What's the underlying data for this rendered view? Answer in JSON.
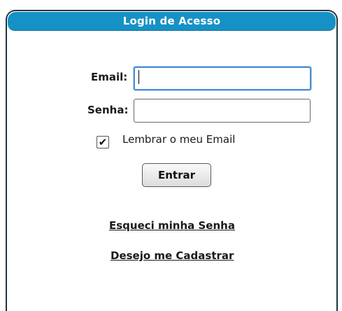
{
  "panel": {
    "title": "Login de Acesso",
    "header_color": "#1691c6",
    "border_color": "#20343f"
  },
  "form": {
    "email_label": "Email:",
    "email_value": "",
    "password_label": "Senha:",
    "password_value": "",
    "remember_label": "Lembrar o meu Email",
    "remember_checked": true,
    "submit_label": "Entrar"
  },
  "links": {
    "forgot_password": "Esqueci minha Senha",
    "register": "Desejo me Cadastrar"
  },
  "icons": {
    "checkmark": "check-icon"
  }
}
